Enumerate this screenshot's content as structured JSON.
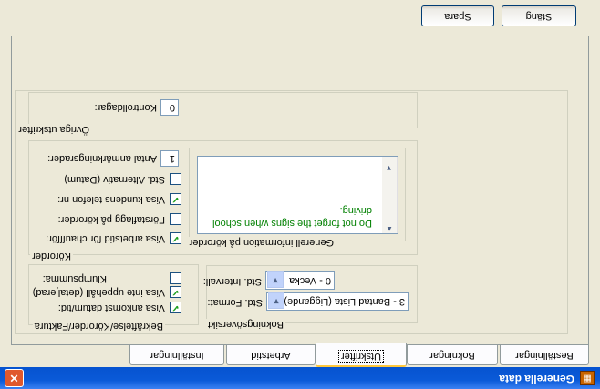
{
  "window": {
    "title": "Generella data",
    "close_glyph": "✕",
    "app_icon": "app-icon"
  },
  "tabs": [
    {
      "label": "Beställningar"
    },
    {
      "label": "Bokningar"
    },
    {
      "label": "Utskrifter",
      "active": true
    },
    {
      "label": "Arbetstid"
    },
    {
      "label": "Inställningar"
    }
  ],
  "groups": {
    "bekraftelse": {
      "legend": "Bekräftelse/Körorder/Faktura",
      "items": [
        {
          "label": "Visa ankomst datum/tid:",
          "checked": true
        },
        {
          "label": "Visa inte uppehåll (detaljerad)",
          "checked": true
        },
        {
          "label": "Klumpsumma:",
          "checked": false
        }
      ]
    },
    "bokningsoversikt": {
      "legend": "Bokningsöversikt",
      "std_format_label": "Std. Format:",
      "std_format_value": "3 - Bantad Lista (Liggande)",
      "std_interval_label": "Std. Intervall:",
      "std_interval_value": "0 - Vecka"
    },
    "korordrer": {
      "legend": "Körorder",
      "items": [
        {
          "label": "Visa arbetstid för chauffför:",
          "checked": true
        },
        {
          "label": "Förstaflagg på körorder:",
          "checked": false
        },
        {
          "label": "Visa kundens telefon nr:",
          "checked": true
        },
        {
          "label": "Std. Alternativ (Datum)",
          "checked": false
        }
      ],
      "antal_label": "Antal anmärkningsrader:",
      "antal_value": "1",
      "general_info_legend": "Generell information på körorder",
      "general_info_text": [
        "Do not forget the signs when school",
        "driving."
      ]
    },
    "ovriga": {
      "legend": "Övriga utskrifter",
      "kontrolldagar_label": "Kontrolldagar:",
      "kontrolldagar_value": "0"
    }
  },
  "buttons": {
    "spara": "Spara",
    "stang": "Stäng"
  },
  "colors": {
    "titlebar": "#0a5ad8",
    "memo_text": "#008000",
    "check_mark": "#21a121"
  }
}
